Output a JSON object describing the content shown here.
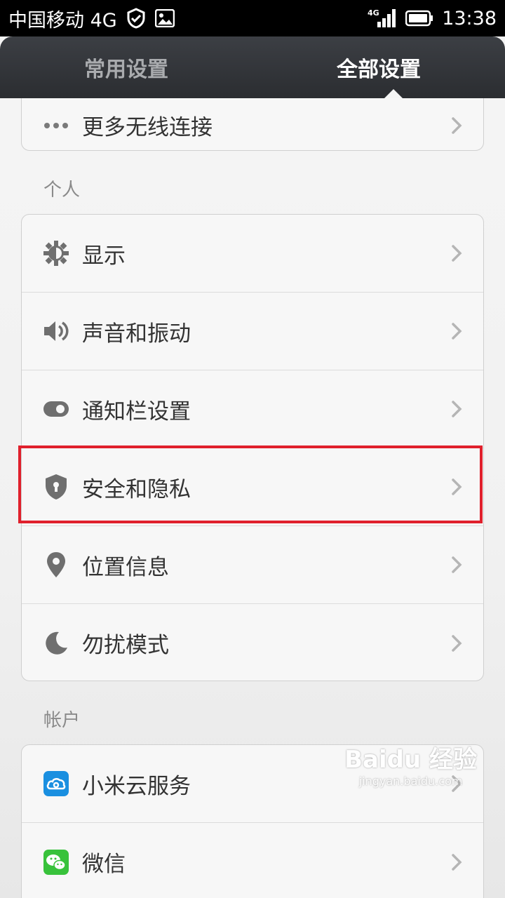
{
  "status_bar": {
    "carrier": "中国移动 4G",
    "network_label": "4G",
    "time": "13:38"
  },
  "tabs": [
    {
      "label": "常用设置",
      "active": false
    },
    {
      "label": "全部设置",
      "active": true
    }
  ],
  "sections": {
    "wireless": {
      "items": [
        {
          "label": "更多无线连接",
          "icon": "more-dots-icon"
        }
      ]
    },
    "personal": {
      "header": "个人",
      "items": [
        {
          "label": "显示",
          "icon": "brightness-icon"
        },
        {
          "label": "声音和振动",
          "icon": "speaker-icon"
        },
        {
          "label": "通知栏设置",
          "icon": "toggle-icon"
        },
        {
          "label": "安全和隐私",
          "icon": "shield-lock-icon",
          "highlighted": true
        },
        {
          "label": "位置信息",
          "icon": "location-pin-icon"
        },
        {
          "label": "勿扰模式",
          "icon": "moon-icon"
        }
      ]
    },
    "account": {
      "header": "帐户",
      "items": [
        {
          "label": "小米云服务",
          "icon": "cloud-icon"
        },
        {
          "label": "微信",
          "icon": "wechat-icon"
        }
      ]
    }
  },
  "watermark": {
    "logo": "Baidu 经验",
    "url": "jingyan.baidu.com"
  },
  "colors": {
    "highlight": "#e0202c",
    "tabbar": "#2b2d31",
    "cloud_blue": "#1a8fe0",
    "wechat_green": "#38c23b"
  }
}
